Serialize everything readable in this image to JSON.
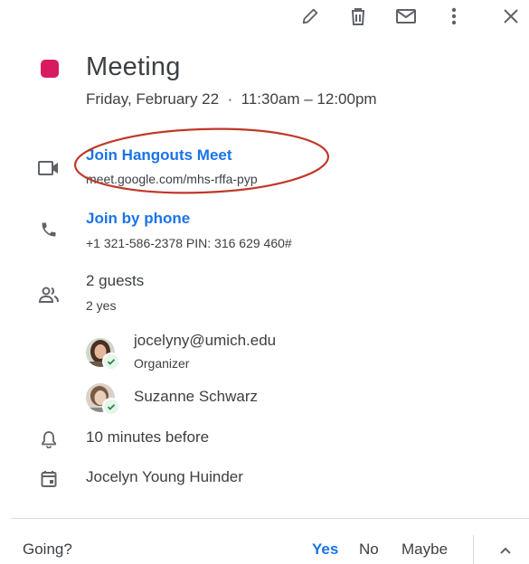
{
  "event": {
    "title": "Meeting",
    "color": "#d81b60",
    "datetime": "Friday, February 22  ·  11:30am – 12:00pm"
  },
  "toolbar": {
    "icons": [
      "edit-icon",
      "delete-icon",
      "email-icon",
      "more-options-icon",
      "close-icon"
    ]
  },
  "hangouts": {
    "link_label": "Join Hangouts Meet",
    "url": "meet.google.com/mhs-rffa-pyp",
    "annotation_color": "#c0392b"
  },
  "phone": {
    "link_label": "Join by phone",
    "details": "+1 321-586-2378 PIN: 316 629 460#"
  },
  "guests": {
    "count_label": "2 guests",
    "summary": "2 yes",
    "list": [
      {
        "name": "jocelyny@umich.edu",
        "role": "Organizer"
      },
      {
        "name": "Suzanne Schwarz",
        "role": ""
      }
    ]
  },
  "reminder": {
    "text": "10 minutes before"
  },
  "calendar": {
    "owner": "Jocelyn Young Huinder"
  },
  "rsvp": {
    "prompt": "Going?",
    "yes": "Yes",
    "no": "No",
    "maybe": "Maybe",
    "selected": "Yes",
    "accent": "#1a73e8"
  }
}
